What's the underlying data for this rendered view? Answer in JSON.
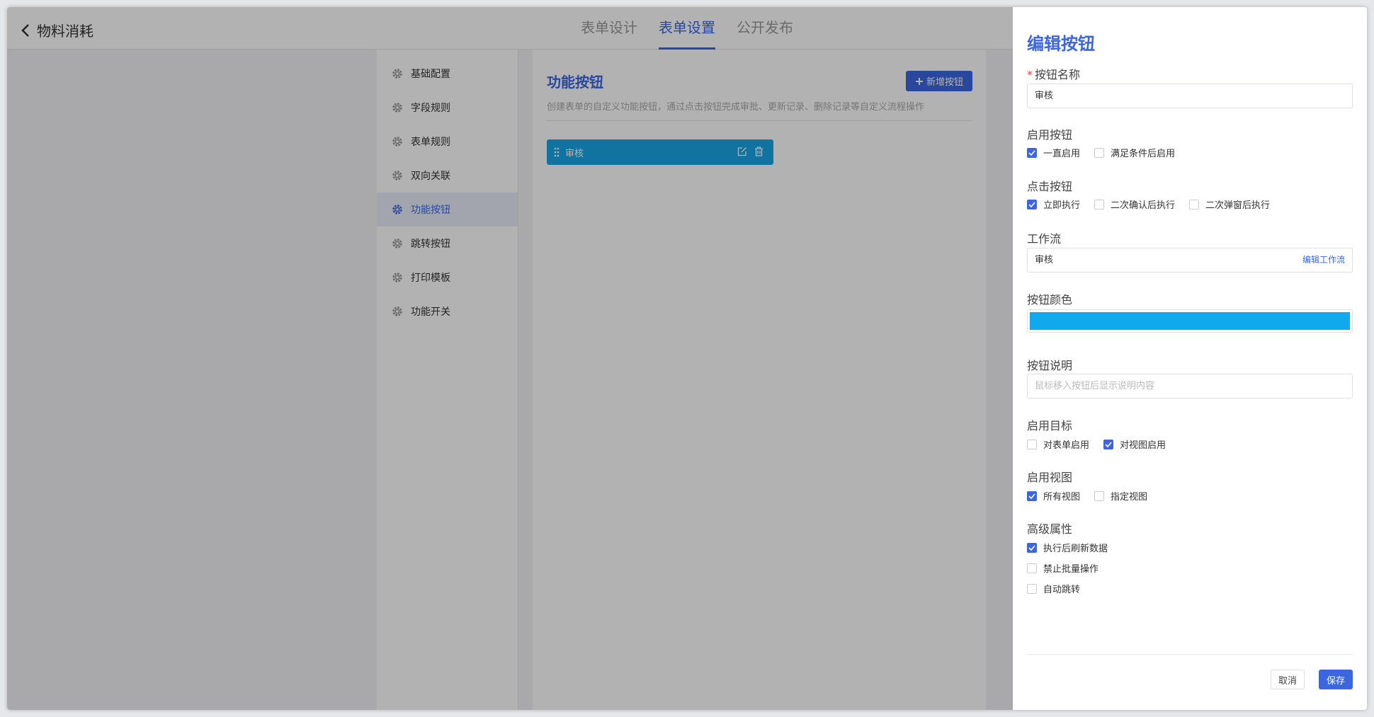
{
  "header": {
    "back_label": "物料消耗",
    "tabs": [
      "表单设计",
      "表单设置",
      "公开发布"
    ],
    "active_tab": 1
  },
  "sidebar": {
    "items": [
      "基础配置",
      "字段规则",
      "表单规则",
      "双向关联",
      "功能按钮",
      "跳转按钮",
      "打印模板",
      "功能开关"
    ],
    "active_index": 4
  },
  "content": {
    "title": "功能按钮",
    "description": "创建表单的自定义功能按钮，通过点击按钮完成审批、更新记录、删除记录等自定义流程操作",
    "add_button": "新增按钮",
    "buttons": [
      {
        "label": "审核",
        "color": "#19a7e6"
      }
    ]
  },
  "drawer": {
    "title": "编辑按钮",
    "name_label": "按钮名称",
    "name_value": "审核",
    "enable_label": "启用按钮",
    "enable_options": [
      "一直启用",
      "满足条件后启用"
    ],
    "click_label": "点击按钮",
    "click_options": [
      "立即执行",
      "二次确认后执行",
      "二次弹窗后执行"
    ],
    "workflow_label": "工作流",
    "workflow_value": "审核",
    "workflow_link": "编辑工作流",
    "color_label": "按钮颜色",
    "color_value": "#10a9ee",
    "desc_label": "按钮说明",
    "desc_placeholder": "鼠标移入按钮后显示说明内容",
    "target_label": "启用目标",
    "target_options": [
      "对表单启用",
      "对视图启用"
    ],
    "view_label": "启用视图",
    "view_options": [
      "所有视图",
      "指定视图"
    ],
    "advanced_label": "高级属性",
    "advanced_options": [
      "执行后刷新数据",
      "禁止批量操作",
      "自动跳转"
    ],
    "cancel": "取消",
    "save": "保存"
  },
  "colors": {
    "accent": "#3b66e0",
    "button_blue": "#19a7e6",
    "required": "#e04040"
  }
}
